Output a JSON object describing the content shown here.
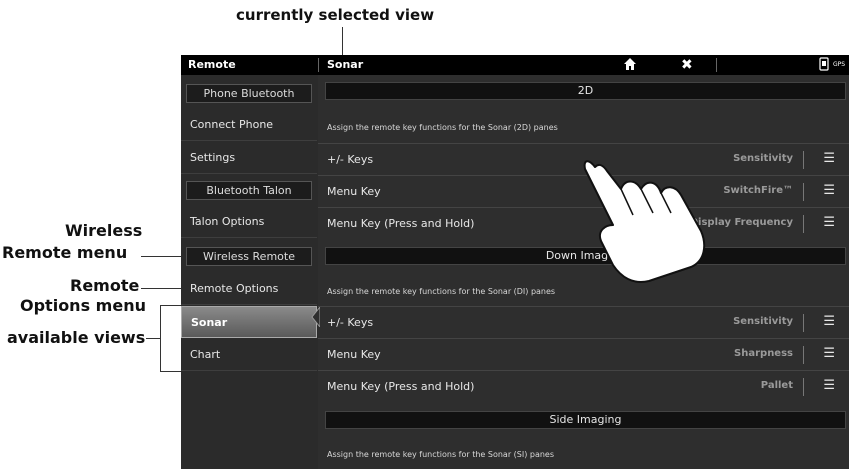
{
  "callouts": {
    "current_view": "currently selected view",
    "wireless_line1": "Wireless",
    "wireless_line2": "Remote menu",
    "remote_line1": "Remote",
    "remote_line2": "Options menu",
    "available_views": "available views"
  },
  "topbar": {
    "left_title": "Remote",
    "right_title": "Sonar",
    "home_icon": "home-icon",
    "close_icon": "close-icon",
    "gps_label": "GPS"
  },
  "sidebar": {
    "items": [
      {
        "label": "Phone Bluetooth",
        "type": "header"
      },
      {
        "label": "Connect Phone",
        "type": "item"
      },
      {
        "label": "Settings",
        "type": "item"
      },
      {
        "label": "Bluetooth Talon",
        "type": "header"
      },
      {
        "label": "Talon Options",
        "type": "item"
      },
      {
        "label": "Wireless Remote",
        "type": "header"
      },
      {
        "label": "Remote Options",
        "type": "item"
      },
      {
        "label": "Sonar",
        "type": "item",
        "selected": true
      },
      {
        "label": "Chart",
        "type": "item"
      }
    ]
  },
  "sections": [
    {
      "title": "2D",
      "description": "Assign the remote key functions for the Sonar (2D) panes",
      "rows": [
        {
          "label": "+/- Keys",
          "value": "Sensitivity"
        },
        {
          "label": "Menu Key",
          "value": "SwitchFire™"
        },
        {
          "label": "Menu Key (Press and Hold)",
          "value": "Display Frequency"
        }
      ]
    },
    {
      "title": "Down Imaging",
      "description": "Assign the remote key functions for the Sonar (DI) panes",
      "rows": [
        {
          "label": "+/- Keys",
          "value": "Sensitivity"
        },
        {
          "label": "Menu Key",
          "value": "Sharpness"
        },
        {
          "label": "Menu Key (Press and Hold)",
          "value": "Pallet"
        }
      ]
    },
    {
      "title": "Side Imaging",
      "description": "Assign the remote key functions for the Sonar (SI) panes",
      "rows": []
    }
  ],
  "colors": {
    "accent": "#ffffff",
    "bar": "#000000",
    "panel": "#2e2e2e"
  }
}
